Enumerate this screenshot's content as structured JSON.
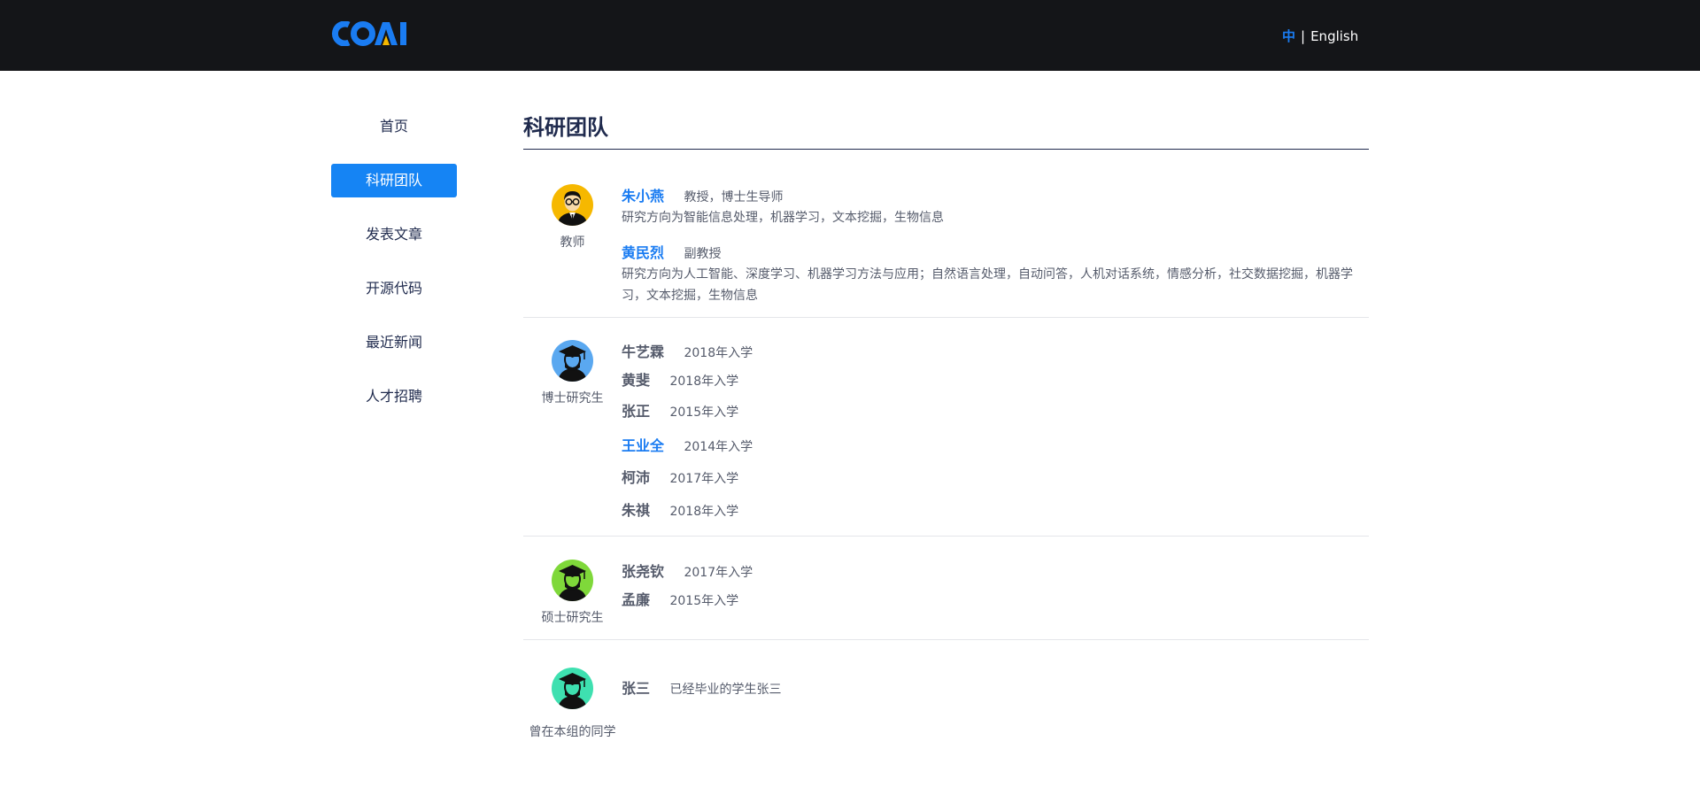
{
  "header": {
    "logo_text": "COAI",
    "lang_zh": "中",
    "lang_sep": "|",
    "lang_en": "English"
  },
  "sidebar": {
    "items": [
      {
        "label": "首页",
        "active": false
      },
      {
        "label": "科研团队",
        "active": true
      },
      {
        "label": "发表文章",
        "active": false
      },
      {
        "label": "开源代码",
        "active": false
      },
      {
        "label": "最近新闻",
        "active": false
      },
      {
        "label": "人才招聘",
        "active": false
      }
    ]
  },
  "main": {
    "title": "科研团队",
    "groups": [
      {
        "label": "教师",
        "icon": "teacher-avatar-icon",
        "color": "#f6b800",
        "members": [
          {
            "name": "朱小燕",
            "title": "教授，博士生导师",
            "desc": "研究方向为智能信息处理，机器学习，文本挖掘，生物信息"
          },
          {
            "name": "黄民烈",
            "title": "副教授",
            "desc": "研究方向为人工智能、深度学习、机器学习方法与应用；自然语言处理，自动问答，人机对话系统，情感分析，社交数据挖掘，机器学习，文本挖掘，生物信息"
          }
        ]
      },
      {
        "label": "博士研究生",
        "icon": "graduate-avatar-icon",
        "color": "#5aa8f0",
        "members": [
          {
            "name": "牛艺霖",
            "title": "2018年入学"
          },
          {
            "name": "黄斐",
            "title": "2018年入学"
          },
          {
            "name": "张正",
            "title": "2015年入学"
          },
          {
            "name": "王业全",
            "title": "2014年入学"
          },
          {
            "name": "柯沛",
            "title": "2017年入学"
          },
          {
            "name": "朱祺",
            "title": "2018年入学"
          }
        ]
      },
      {
        "label": "硕士研究生",
        "icon": "graduate-avatar-icon",
        "color": "#7fd83a",
        "members": [
          {
            "name": "张尧钦",
            "title": "2017年入学"
          },
          {
            "name": "孟廉",
            "title": "2015年入学"
          }
        ]
      },
      {
        "label": "曾在本组的同学",
        "icon": "graduate-avatar-icon",
        "color": "#3ee0b0",
        "members": [
          {
            "name": "张三",
            "title": "已经毕业的学生张三"
          }
        ]
      }
    ]
  }
}
